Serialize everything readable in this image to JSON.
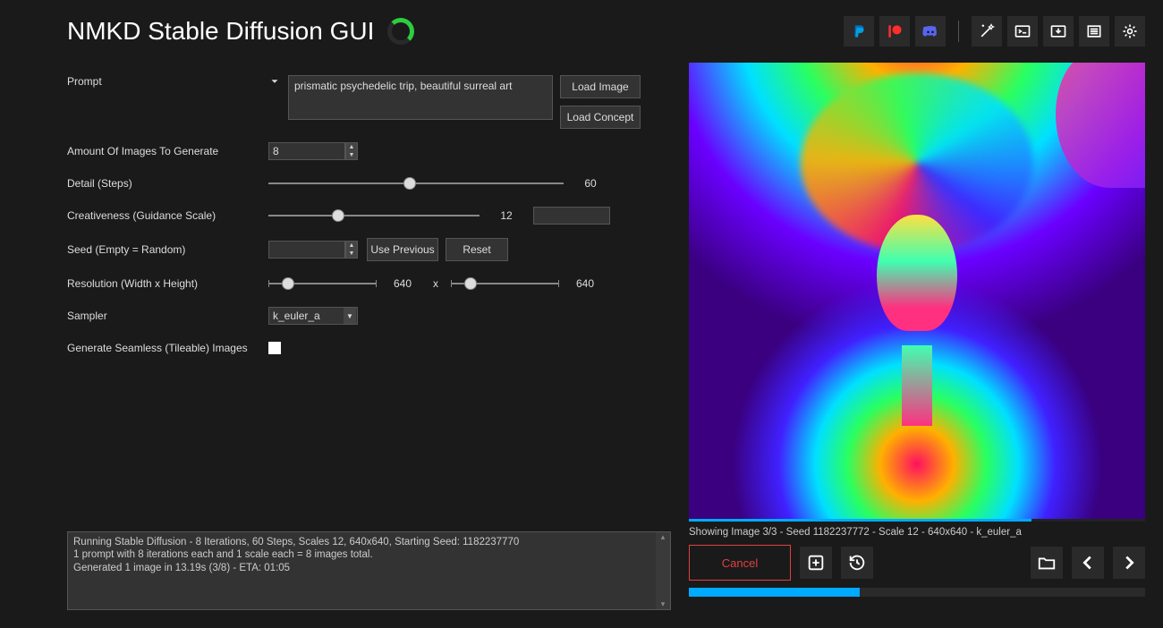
{
  "app": {
    "title": "NMKD Stable Diffusion GUI"
  },
  "icons": {
    "paypal": "paypal",
    "patreon": "patreon",
    "discord": "discord",
    "wand": "wand",
    "console": "console",
    "download": "download",
    "list": "list",
    "gear": "gear"
  },
  "labels": {
    "prompt": "Prompt",
    "amount": "Amount Of Images To Generate",
    "detail": "Detail (Steps)",
    "creative": "Creativeness (Guidance Scale)",
    "seed": "Seed (Empty = Random)",
    "resolution": "Resolution (Width x Height)",
    "sampler": "Sampler",
    "seamless": "Generate Seamless (Tileable) Images"
  },
  "prompt": {
    "text": "prismatic psychedelic trip, beautiful surreal art"
  },
  "buttons": {
    "load_image": "Load Image",
    "load_concept": "Load Concept",
    "use_previous": "Use Previous",
    "reset": "Reset",
    "cancel": "Cancel"
  },
  "values": {
    "amount": "8",
    "steps": "60",
    "steps_pct": 48,
    "guidance": "12",
    "guidance_pct": 33,
    "seed": "",
    "width": "640",
    "width_pct": 18,
    "times": "x",
    "height": "640",
    "height_pct": 18,
    "sampler": "k_euler_a",
    "seamless_checked": false
  },
  "log": {
    "l1": "Running Stable Diffusion - 8 Iterations, 60 Steps, Scales 12, 640x640, Starting Seed: 1182237770",
    "l2": "1 prompt with 8 iterations each and 1 scale each = 8 images total.",
    "l3": "Generated 1 image in 13.19s (3/8) - ETA: 01:05"
  },
  "preview": {
    "infoline": "Showing Image 3/3 - Seed 1182237772 - Scale 12 - 640x640 - k_euler_a",
    "thin_progress_pct": 75,
    "fat_progress_pct": 37.5
  }
}
